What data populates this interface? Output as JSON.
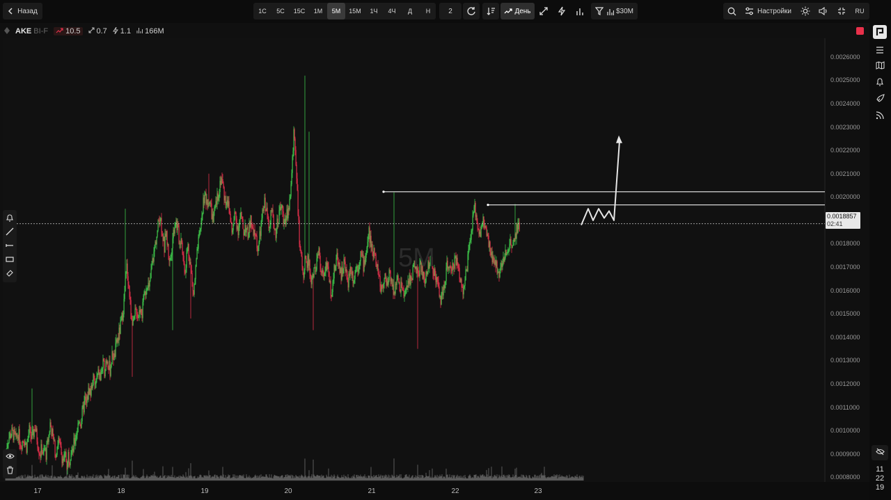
{
  "topbar": {
    "back_label": "Назад",
    "timeframes": [
      "1С",
      "5С",
      "15С",
      "1М",
      "5М",
      "15М",
      "1Ч",
      "4Ч",
      "Д",
      "Н"
    ],
    "active_timeframe": "5М",
    "multiplier": "2",
    "day_label": "День",
    "filter_value": "$30M",
    "settings_label": "Настройки",
    "lang": "RU"
  },
  "symbol": {
    "name": "AKE",
    "sub": "BI-F",
    "stat_change": "10.5",
    "stat_range": "0.7",
    "stat_speed": "1.1",
    "stat_volume": "166M"
  },
  "price_tag": {
    "price": "0.0018857",
    "countdown": "02:41"
  },
  "watermark": "5M",
  "clock": {
    "h": "11",
    "m": "22",
    "s": "19"
  },
  "y_ticks": [
    "0.0026000",
    "0.0025000",
    "0.0024000",
    "0.0023000",
    "0.0022000",
    "0.0021000",
    "0.0020000",
    "0.0019000",
    "0.0018000",
    "0.0017000",
    "0.0016000",
    "0.0015000",
    "0.0014000",
    "0.0013000",
    "0.0012000",
    "0.0011000",
    "0.0010000",
    "0.0009000",
    "0.0008000"
  ],
  "x_ticks": [
    "17",
    "18",
    "19",
    "20",
    "21",
    "22",
    "23"
  ],
  "colors": {
    "up": "#3ec64a",
    "down": "#e0304a",
    "line": "#d8d8d8",
    "background": "#101010"
  },
  "chart_data": {
    "type": "candlestick",
    "ylim": [
      0.00078,
      0.00268
    ],
    "current_price": 0.0018857,
    "levels": [
      0.0020225,
      0.0019664
    ],
    "path_x": [
      0,
      3,
      6,
      9,
      12,
      15,
      18,
      22,
      26,
      30,
      34,
      38,
      42,
      46,
      48,
      50,
      52,
      54,
      56,
      58,
      60,
      62,
      64,
      66,
      68,
      70,
      72,
      74,
      76,
      78,
      80,
      82,
      84,
      86,
      88,
      90,
      92,
      94,
      96,
      98,
      100,
      102,
      104,
      106,
      108,
      110,
      112,
      114,
      116,
      118,
      120,
      122,
      124,
      126,
      128,
      130,
      132,
      134,
      136,
      138,
      140,
      142,
      144,
      146,
      148,
      150,
      152,
      154,
      156,
      158,
      160,
      162,
      164,
      166,
      168,
      170,
      172,
      174,
      176,
      178,
      180,
      182,
      184,
      186,
      188,
      190,
      192,
      194,
      196,
      198,
      200,
      202,
      204,
      206,
      208,
      210,
      212,
      214,
      216,
      218,
      220,
      222,
      224,
      226,
      228,
      230,
      232,
      234,
      236,
      238,
      240,
      242,
      244,
      246,
      248,
      250,
      252,
      254,
      256,
      258,
      260,
      262,
      264,
      266,
      268,
      270,
      272,
      274,
      276,
      278,
      280,
      282,
      284,
      286,
      288,
      290,
      292,
      294,
      296,
      298,
      300,
      302,
      304,
      306,
      308,
      310,
      312,
      314,
      316,
      318,
      320,
      322,
      324,
      326,
      328,
      330,
      332,
      334,
      336,
      338,
      340,
      342,
      344,
      346,
      348,
      350,
      352,
      354,
      356,
      358,
      360,
      362,
      364,
      366,
      368,
      370,
      372,
      374,
      376,
      378,
      380,
      382,
      384,
      386,
      388,
      390,
      392,
      394,
      396,
      398,
      400,
      402,
      404,
      406,
      408,
      410,
      412,
      414,
      416,
      418,
      420,
      422,
      424,
      426,
      428,
      430,
      432,
      434,
      436,
      438,
      440,
      442,
      444,
      446,
      448,
      450,
      452,
      454,
      456,
      458,
      460,
      462,
      464,
      466,
      468,
      470,
      472,
      474,
      476,
      478,
      480,
      482,
      484,
      486,
      488,
      490,
      492,
      494,
      496,
      498,
      500,
      502,
      504,
      506,
      508,
      510,
      512,
      514,
      516,
      518,
      520,
      522,
      524,
      526,
      528,
      530,
      532,
      534,
      536,
      538,
      540,
      542,
      544,
      546,
      548,
      550,
      552,
      554,
      556,
      558,
      560,
      562,
      564,
      566,
      568,
      570,
      572,
      574,
      576,
      578,
      580,
      582,
      584,
      586,
      588,
      590,
      592,
      594,
      596,
      598,
      600,
      602,
      604,
      606,
      608,
      610,
      612,
      614,
      616,
      618,
      620,
      622,
      624,
      626,
      628,
      630,
      632,
      634,
      636,
      638,
      640,
      642,
      644,
      646,
      648,
      650,
      652,
      654,
      656,
      658,
      660,
      662,
      664,
      666,
      668,
      670,
      672,
      674,
      676,
      678,
      680,
      682,
      684,
      686,
      688,
      690,
      692,
      694,
      696,
      698,
      700,
      702,
      704,
      706,
      708,
      710,
      712,
      714,
      716,
      718,
      720,
      722,
      724,
      726,
      728,
      730,
      732,
      734,
      736,
      738,
      740,
      742,
      744,
      746,
      748,
      750,
      752,
      754,
      756,
      758,
      760,
      762,
      764,
      766,
      768,
      770,
      772,
      774,
      776,
      778,
      780,
      782,
      784,
      786,
      788,
      790,
      792,
      794,
      796,
      798,
      800,
      802,
      804,
      806,
      808,
      810,
      812,
      814,
      816,
      818,
      820,
      822,
      824,
      826,
      828,
      830
    ],
    "path_y": [
      0.0009,
      0.00096,
      0.00098,
      0.00099,
      0.00098,
      0.00096,
      0.00099,
      0.00094,
      0.00097,
      0.00093,
      0.001,
      0.00096,
      0.00102,
      0.00095,
      0.00092,
      0.0009,
      0.00093,
      0.00089,
      0.00092,
      0.0009,
      0.00094,
      0.00098,
      0.00103,
      0.001,
      0.00097,
      0.00093,
      0.0009,
      0.00094,
      0.00096,
      0.00093,
      0.0009,
      0.00088,
      0.00087,
      0.00089,
      0.00086,
      0.0009,
      0.00088,
      0.00092,
      0.0009,
      0.00094,
      0.00097,
      0.00099,
      0.00102,
      0.00105,
      0.00103,
      0.00107,
      0.0011,
      0.00113,
      0.00111,
      0.00115,
      0.00118,
      0.00116,
      0.0012,
      0.00122,
      0.00119,
      0.00121,
      0.00123,
      0.00125,
      0.00122,
      0.00126,
      0.00128,
      0.00126,
      0.0013,
      0.00131,
      0.00128,
      0.00126,
      0.0013,
      0.00133,
      0.00131,
      0.00135,
      0.00138,
      0.0014,
      0.00143,
      0.00146,
      0.0015,
      0.00155,
      0.00163,
      0.0017,
      0.00165,
      0.00158,
      0.0015,
      0.00148,
      0.00145,
      0.0015,
      0.00152,
      0.00149,
      0.00151,
      0.00154,
      0.0015,
      0.00155,
      0.00158,
      0.00162,
      0.00164,
      0.0016,
      0.00165,
      0.0017,
      0.00174,
      0.00178,
      0.00182,
      0.00185,
      0.0019,
      0.00192,
      0.00188,
      0.00183,
      0.00178,
      0.00185,
      0.00181,
      0.00176,
      0.00172,
      0.00178,
      0.00183,
      0.00187,
      0.0019,
      0.00188,
      0.00185,
      0.0018,
      0.00184,
      0.00178,
      0.00171,
      0.00169,
      0.00175,
      0.00179,
      0.00174,
      0.0017,
      0.00163,
      0.00158,
      0.00165,
      0.00172,
      0.00178,
      0.00182,
      0.00187,
      0.00192,
      0.00198,
      0.00202,
      0.00198,
      0.00195,
      0.002,
      0.00197,
      0.00193,
      0.0019,
      0.00193,
      0.00196,
      0.00199,
      0.00203,
      0.00206,
      0.00209,
      0.00205,
      0.00201,
      0.00198,
      0.002,
      0.00196,
      0.00193,
      0.00188,
      0.00185,
      0.0019,
      0.00193,
      0.00189,
      0.00186,
      0.0019,
      0.00192,
      0.00188,
      0.00185,
      0.00188,
      0.00186,
      0.00183,
      0.00187,
      0.0019,
      0.00186,
      0.00183,
      0.00185,
      0.00182,
      0.00178,
      0.0018,
      0.00185,
      0.0019,
      0.00194,
      0.00198,
      0.00195,
      0.00192,
      0.00189,
      0.00191,
      0.00194,
      0.0019,
      0.00187,
      0.00185,
      0.00189,
      0.00192,
      0.00194,
      0.00196,
      0.00193,
      0.0019,
      0.00188,
      0.00192,
      0.00195,
      0.00198,
      0.00205,
      0.00215,
      0.00228,
      0.00222,
      0.0021,
      0.00195,
      0.0018,
      0.00174,
      0.0017,
      0.00168,
      0.00172,
      0.0017,
      0.00174,
      0.00171,
      0.00166,
      0.00163,
      0.00167,
      0.00171,
      0.00169,
      0.00173,
      0.00176,
      0.00172,
      0.00168,
      0.00165,
      0.00169,
      0.00172,
      0.00169,
      0.00166,
      0.00162,
      0.0016,
      0.00164,
      0.00168,
      0.00171,
      0.00175,
      0.00173,
      0.0017,
      0.00167,
      0.00169,
      0.00172,
      0.00169,
      0.00166,
      0.00164,
      0.00168,
      0.0017,
      0.00167,
      0.00165,
      0.00168,
      0.00171,
      0.0017,
      0.00173,
      0.00176,
      0.00174,
      0.00171,
      0.00173,
      0.00177,
      0.0018,
      0.00185,
      0.00181,
      0.00178,
      0.00175,
      0.00177,
      0.00173,
      0.0017,
      0.00166,
      0.00163,
      0.0016,
      0.00163,
      0.00167,
      0.00164,
      0.00161,
      0.00165,
      0.00168,
      0.00165,
      0.00162,
      0.0016,
      0.00163,
      0.00165,
      0.00162,
      0.0016,
      0.00163,
      0.00161,
      0.00158,
      0.00157,
      0.0016,
      0.00163,
      0.00166,
      0.00164,
      0.00167,
      0.0017,
      0.00172,
      0.00169,
      0.00166,
      0.00168,
      0.00171,
      0.00169,
      0.00166,
      0.00163,
      0.00166,
      0.00169,
      0.00172,
      0.00175,
      0.00173,
      0.0017,
      0.00168,
      0.00166,
      0.00163,
      0.0016,
      0.00158,
      0.00156,
      0.00158,
      0.00162,
      0.00166,
      0.0017,
      0.00172,
      0.00169,
      0.00166,
      0.00169,
      0.00172,
      0.00175,
      0.00172,
      0.00169,
      0.00167,
      0.00165,
      0.00162,
      0.0016,
      0.00164,
      0.00168,
      0.00173,
      0.00178,
      0.00183,
      0.00187,
      0.00192,
      0.00195,
      0.00192,
      0.00189,
      0.00186,
      0.00184,
      0.00187,
      0.0019,
      0.00188,
      0.00185,
      0.00182,
      0.00179,
      0.00177,
      0.00175,
      0.00173,
      0.0017,
      0.00172,
      0.00169,
      0.00167,
      0.0017,
      0.00173,
      0.00171,
      0.00174,
      0.00176,
      0.00174,
      0.00178,
      0.00181,
      0.00179,
      0.00182,
      0.00185,
      0.00183,
      0.00186,
      0.00189,
      0.00188
    ],
    "arrow_path": [
      [
        835,
        0.00188
      ],
      [
        845,
        0.00195
      ],
      [
        852,
        0.0019
      ],
      [
        860,
        0.00195
      ],
      [
        868,
        0.00191
      ],
      [
        875,
        0.00194
      ],
      [
        882,
        0.0019
      ],
      [
        890,
        0.00224
      ]
    ]
  }
}
